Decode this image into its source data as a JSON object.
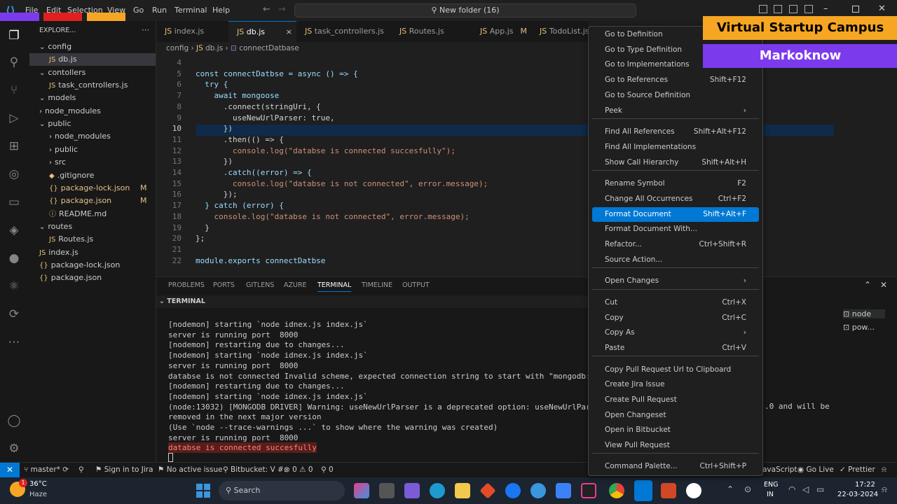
{
  "menubar": {
    "file": "File",
    "edit": "Edit",
    "selection": "Selection",
    "view": "View",
    "go": "Go",
    "run": "Run",
    "terminal": "Terminal",
    "help": "Help"
  },
  "title_search": "New folder (16)",
  "explorer": {
    "title": "EXPLORE...",
    "tree": [
      {
        "label": "config",
        "kind": "folder-open"
      },
      {
        "label": "db.js",
        "kind": "js"
      },
      {
        "label": "contollers",
        "kind": "folder-open"
      },
      {
        "label": "task_controllers.js",
        "kind": "js"
      },
      {
        "label": "models",
        "kind": "folder-open"
      },
      {
        "label": "node_modules",
        "kind": "folder"
      },
      {
        "label": "public",
        "kind": "folder-open"
      },
      {
        "label": "node_modules",
        "kind": "folder"
      },
      {
        "label": "public",
        "kind": "folder"
      },
      {
        "label": "src",
        "kind": "folder"
      },
      {
        "label": ".gitignore",
        "kind": "git"
      },
      {
        "label": "package-lock.json",
        "kind": "json",
        "badge": "M"
      },
      {
        "label": "package.json",
        "kind": "json",
        "badge": "M"
      },
      {
        "label": "README.md",
        "kind": "md"
      },
      {
        "label": "routes",
        "kind": "folder-open"
      },
      {
        "label": "Routes.js",
        "kind": "js"
      },
      {
        "label": "index.js",
        "kind": "js"
      },
      {
        "label": "package-lock.json",
        "kind": "json"
      },
      {
        "label": "package.json",
        "kind": "json"
      }
    ]
  },
  "tabs": [
    {
      "label": "index.js"
    },
    {
      "label": "db.js",
      "close": "×"
    },
    {
      "label": "task_controllers.js"
    },
    {
      "label": "Routes.js"
    },
    {
      "label": "App.js",
      "badge": "M"
    },
    {
      "label": "TodoList.js"
    }
  ],
  "breadcrumb": {
    "a": "config",
    "b": "db.js",
    "c": "connectDatbase"
  },
  "code": [
    {
      "n": "4",
      "t": ""
    },
    {
      "n": "5",
      "t": "const connectDatbse = async () => {"
    },
    {
      "n": "6",
      "t": "  try {"
    },
    {
      "n": "7",
      "t": "    await mongoose"
    },
    {
      "n": "8",
      "t": "      .connect(stringUri, {"
    },
    {
      "n": "9",
      "t": "        useNewUrlParser: true,"
    },
    {
      "n": "10",
      "t": "      })"
    },
    {
      "n": "11",
      "t": "      .then(() => {"
    },
    {
      "n": "12",
      "t": "        console.log(\"databse is connected succesfully\");"
    },
    {
      "n": "13",
      "t": "      })"
    },
    {
      "n": "14",
      "t": "      .catch((error) => {"
    },
    {
      "n": "15",
      "t": "        console.log(\"databse is not connected\", error.message);"
    },
    {
      "n": "16",
      "t": "      });"
    },
    {
      "n": "17",
      "t": "  } catch (error) {"
    },
    {
      "n": "18",
      "t": "    console.log(\"databse is not connected\", error.message);"
    },
    {
      "n": "19",
      "t": "  }"
    },
    {
      "n": "20",
      "t": "};"
    },
    {
      "n": "21",
      "t": ""
    },
    {
      "n": "22",
      "t": "module.exports connectDatbse"
    }
  ],
  "panel_tabs": [
    "PROBLEMS",
    "PORTS",
    "GITLENS",
    "AZURE",
    "TERMINAL",
    "TIMELINE",
    "OUTPUT"
  ],
  "terminal_header": "TERMINAL",
  "terminal_lines": [
    "[nodemon] starting `node idnex.js index.js`",
    "server is running port  8000",
    "[nodemon] restarting due to changes...",
    "[nodemon] starting `node idnex.js index.js`",
    "server is running port  8000",
    "databse is not connected Invalid scheme, expected connection string to start with \"mongodb://\" or \"m",
    "[nodemon] restarting due to changes...",
    "[nodemon] starting `node idnex.js index.js`",
    "(node:13032) [MONGODB DRIVER] Warning: useNewUrlParser is a deprecated option: useNewUrlParser has r",
    "removed in the next major version",
    "(Use `node --trace-warnings ...` to show where the warning was created)",
    "server is running port  8000",
    "databse is connected succesfully"
  ],
  "terminal_tail": ".0 and will be",
  "terminal_list": [
    "node",
    "pow..."
  ],
  "context_menu": [
    {
      "label": "Go to Definition",
      "key": ""
    },
    {
      "label": "Go to Type Definition",
      "key": ""
    },
    {
      "label": "Go to Implementations",
      "key": ""
    },
    {
      "label": "Go to References",
      "key": "Shift+F12"
    },
    {
      "label": "Go to Source Definition",
      "key": ""
    },
    {
      "label": "Peek",
      "key": "›"
    },
    {
      "label": "Find All References",
      "key": "Shift+Alt+F12"
    },
    {
      "label": "Find All Implementations",
      "key": ""
    },
    {
      "label": "Show Call Hierarchy",
      "key": "Shift+Alt+H"
    },
    {
      "label": "Rename Symbol",
      "key": "F2"
    },
    {
      "label": "Change All Occurrences",
      "key": "Ctrl+F2"
    },
    {
      "label": "Format Document",
      "key": "Shift+Alt+F"
    },
    {
      "label": "Format Document With...",
      "key": ""
    },
    {
      "label": "Refactor...",
      "key": "Ctrl+Shift+R"
    },
    {
      "label": "Source Action...",
      "key": ""
    },
    {
      "label": "Open Changes",
      "key": "›"
    },
    {
      "label": "Cut",
      "key": "Ctrl+X"
    },
    {
      "label": "Copy",
      "key": "Ctrl+C"
    },
    {
      "label": "Copy As",
      "key": "›"
    },
    {
      "label": "Paste",
      "key": "Ctrl+V"
    },
    {
      "label": "Copy Pull Request Url to Clipboard",
      "key": ""
    },
    {
      "label": "Create Jira Issue",
      "key": ""
    },
    {
      "label": "Create Pull Request",
      "key": ""
    },
    {
      "label": "Open Changeset",
      "key": ""
    },
    {
      "label": "Open in Bitbucket",
      "key": ""
    },
    {
      "label": "View Pull Request",
      "key": ""
    },
    {
      "label": "Command Palette...",
      "key": "Ctrl+Shift+P"
    }
  ],
  "banners": {
    "top": "Virtual Startup Campus",
    "bottom": "Markoknow",
    "top_color": "#f6a623",
    "bottom_color": "#7c3aed"
  },
  "status": {
    "branch": "master*",
    "jira": "Sign in to Jira",
    "issue": "No active issue",
    "bitbucket": "Bitbucket: V #:",
    "errors": "0",
    "warnings": "0",
    "ports": "0",
    "lang": "avaScript",
    "golive": "Go Live",
    "prettier": "Prettier"
  },
  "taskbar": {
    "temp": "36°C",
    "weather": "Haze",
    "search": "Search",
    "lang1": "ENG",
    "lang2": "IN",
    "time": "17:22",
    "date": "22-03-2024",
    "badge": "1"
  },
  "accent": "#0078d4"
}
